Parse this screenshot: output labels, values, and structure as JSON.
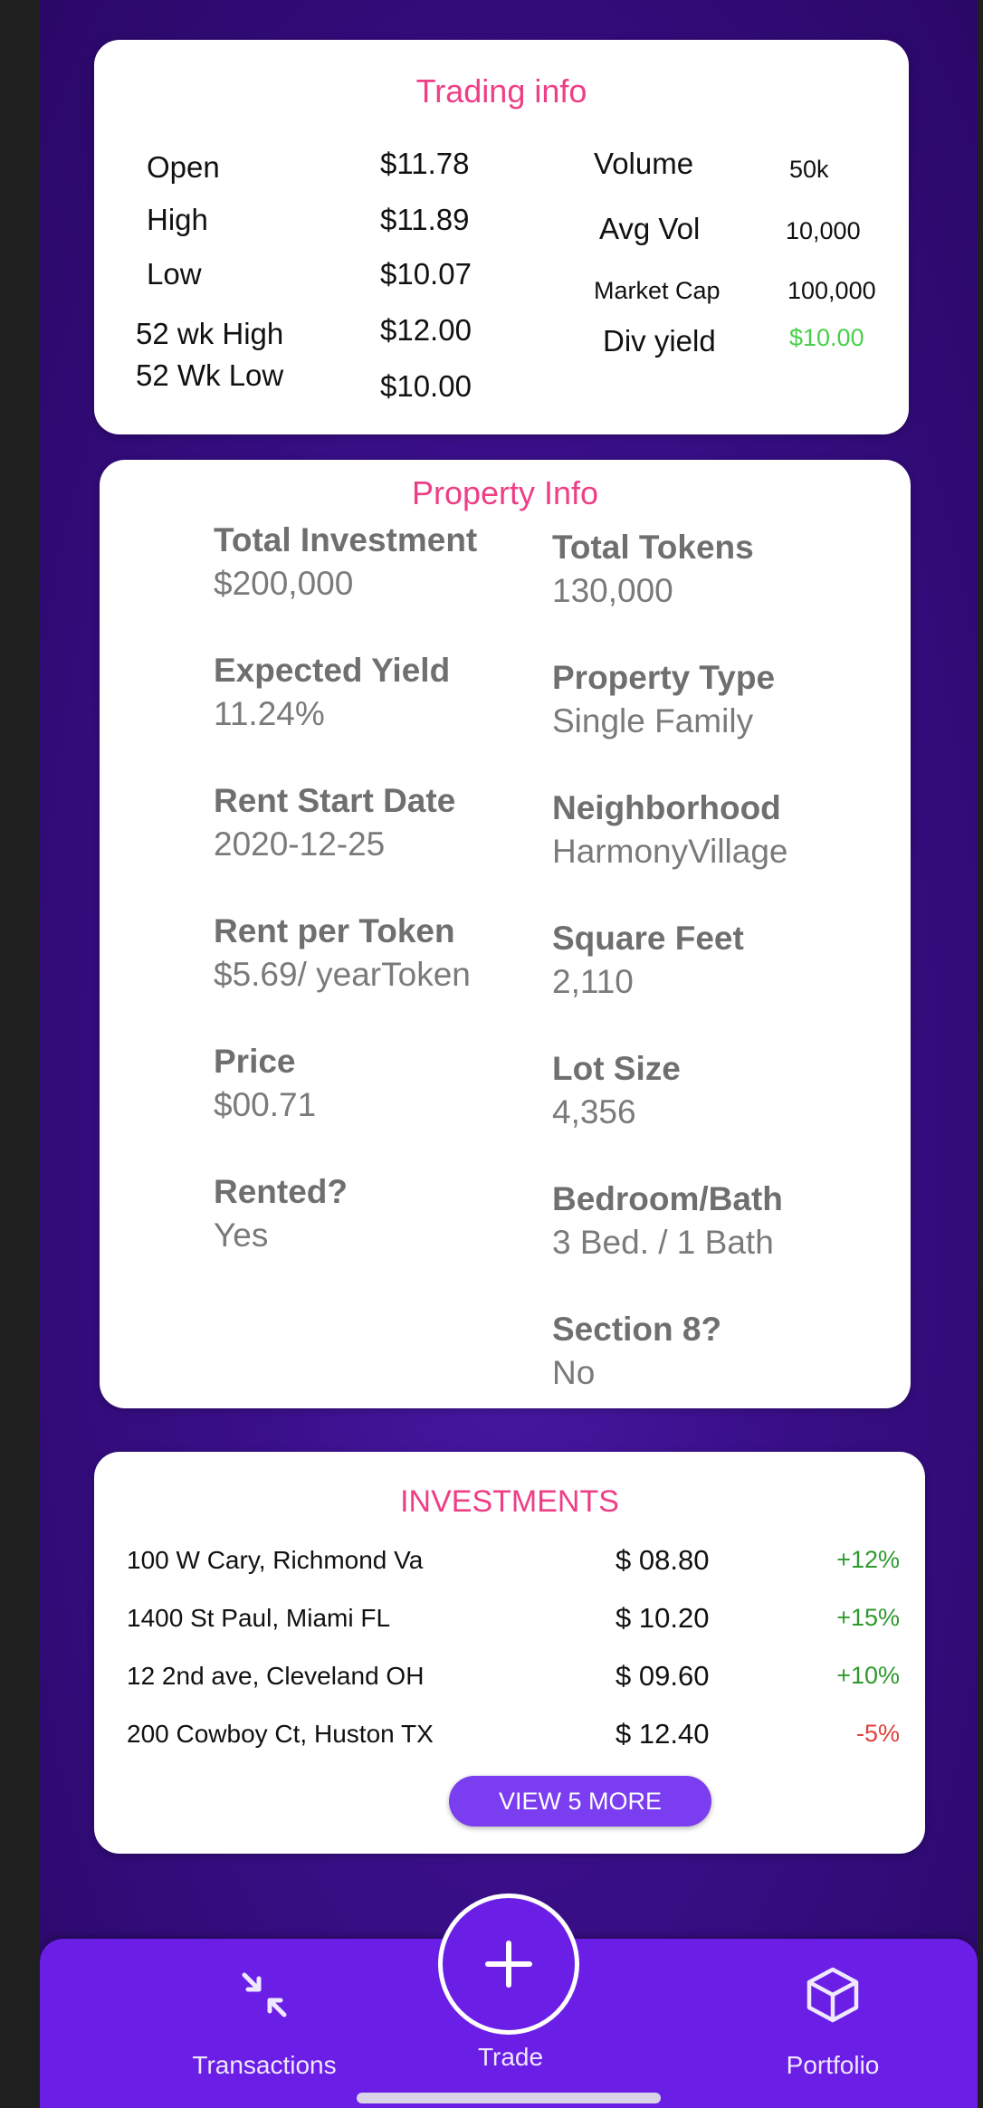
{
  "trading": {
    "title": "Trading info",
    "open_label": "Open",
    "open_value": "$11.78",
    "high_label": "High",
    "high_value": "$11.89",
    "low_label": "Low",
    "low_value": "$10.07",
    "wk52_high_label": "52 wk High",
    "wk52_high_value": "$12.00",
    "wk52_low_label": "52 Wk Low",
    "wk52_low_value": "$10.00",
    "volume_label": "Volume",
    "volume_value": "50k",
    "avg_vol_label": "Avg Vol",
    "avg_vol_value": "10,000",
    "market_cap_label": "Market Cap",
    "market_cap_value": "100,000",
    "div_yield_label": "Div yield",
    "div_yield_value": "$10.00"
  },
  "property": {
    "title": "Property Info",
    "fields": [
      {
        "label": "Total Investment",
        "value": " $200,000"
      },
      {
        "label": "Total Tokens",
        "value": "130,000"
      },
      {
        "label": "Expected Yield",
        "value": "11.24%"
      },
      {
        "label": "Property Type",
        "value": "Single Family"
      },
      {
        "label": "Rent Start Date",
        "value": "2020-12-25"
      },
      {
        "label": "Neighborhood",
        "value": "HarmonyVillage"
      },
      {
        "label": "Rent per Token",
        "value": "$5.69/ yearToken"
      },
      {
        "label": "Square Feet",
        "value": "2,110"
      },
      {
        "label": "Price",
        "value": "$00.71"
      },
      {
        "label": "Lot Size",
        "value": "4,356"
      },
      {
        "label": "Rented?",
        "value": "Yes"
      },
      {
        "label": "Bedroom/Bath",
        "value": "3 Bed. / 1 Bath"
      },
      {
        "label": "Section 8?",
        "value": "No"
      }
    ]
  },
  "investments": {
    "title": "INVESTMENTS",
    "rows": [
      {
        "name": "100 W Cary, Richmond Va",
        "price": "$ 08.80",
        "change": "+12%"
      },
      {
        "name": "1400 St Paul, Miami FL",
        "price": "$ 10.20",
        "change": "+15%"
      },
      {
        "name": "12 2nd ave, Cleveland OH",
        "price": "$ 09.60",
        "change": "+10%"
      },
      {
        "name": "200 Cowboy Ct, Huston TX",
        "price": "$ 12.40",
        "change": "-5%"
      }
    ],
    "view_more_label": "VIEW 5 MORE"
  },
  "nav": {
    "transactions_label": "Transactions",
    "trade_label": "Trade",
    "portfolio_label": "Portfolio"
  },
  "colors": {
    "accent_pink": "#ee3f86",
    "positive": "#2e9a2e",
    "negative": "#e0403a",
    "nav_purple": "#6b1fe6"
  }
}
